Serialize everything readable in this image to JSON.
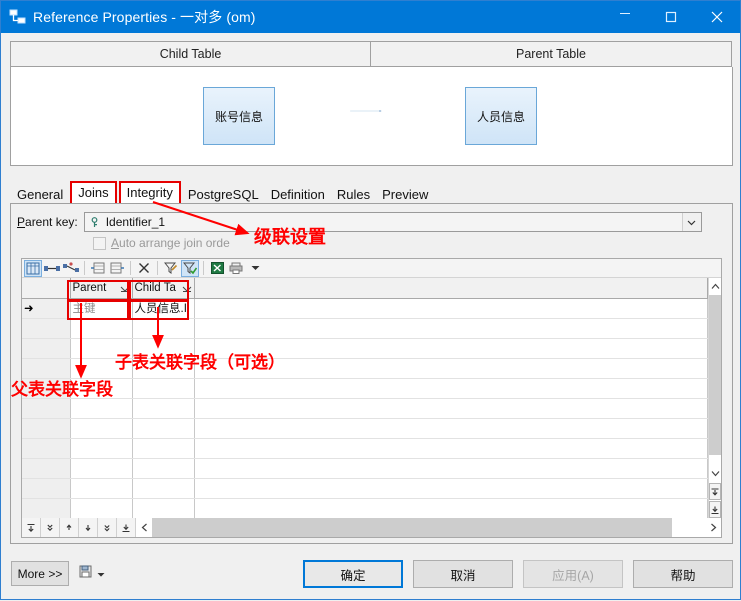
{
  "window": {
    "title": "Reference Properties - 一对多 (om)",
    "icon": "reference-icon",
    "controls": {
      "minimize": "minimize-icon",
      "maximize": "maximize-icon",
      "close": "close-icon"
    },
    "accent": "#0078d7"
  },
  "diagram": {
    "child_header": "Child Table",
    "parent_header": "Parent Table",
    "child_entity": "账号信息",
    "parent_entity": "人员信息",
    "relation": "one-to-many-arrow"
  },
  "tabs": [
    {
      "label": "General",
      "selected": false,
      "highlighted": false
    },
    {
      "label": "Joins",
      "selected": true,
      "highlighted": true
    },
    {
      "label": "Integrity",
      "selected": false,
      "highlighted": true
    },
    {
      "label": "PostgreSQL",
      "selected": false,
      "highlighted": false
    },
    {
      "label": "Definition",
      "selected": false,
      "highlighted": false
    },
    {
      "label": "Rules",
      "selected": false,
      "highlighted": false
    },
    {
      "label": "Preview",
      "selected": false,
      "highlighted": false
    }
  ],
  "joins": {
    "parent_key_label": "Parent key:",
    "parent_key_value": "Identifier_1",
    "parent_key_icon": "key-icon",
    "dropdown_icon": "chevron-down-icon",
    "auto_arrange_label": "Auto arrange join orde",
    "auto_arrange_checked": false,
    "toolbar_icons": [
      "columns-icon",
      "link-icon",
      "auto-link-icon",
      "insert-row-icon",
      "delete-row-icon",
      "remove-icon",
      "filter-icon",
      "filter-apply-icon",
      "excel-export-icon",
      "print-icon",
      "dropdown-icon"
    ],
    "grid": {
      "columns": [
        "",
        "Parent",
        "Child Ta",
        ""
      ],
      "rows": [
        {
          "marker": "➜",
          "parent": "主键",
          "child": "人员信息.I",
          "rest": ""
        },
        {
          "marker": "",
          "parent": "",
          "child": "",
          "rest": ""
        },
        {
          "marker": "",
          "parent": "",
          "child": "",
          "rest": ""
        },
        {
          "marker": "",
          "parent": "",
          "child": "",
          "rest": ""
        },
        {
          "marker": "",
          "parent": "",
          "child": "",
          "rest": ""
        },
        {
          "marker": "",
          "parent": "",
          "child": "",
          "rest": ""
        },
        {
          "marker": "",
          "parent": "",
          "child": "",
          "rest": ""
        },
        {
          "marker": "",
          "parent": "",
          "child": "",
          "rest": ""
        },
        {
          "marker": "",
          "parent": "",
          "child": "",
          "rest": ""
        },
        {
          "marker": "",
          "parent": "",
          "child": "",
          "rest": ""
        },
        {
          "marker": "",
          "parent": "",
          "child": "",
          "rest": ""
        }
      ],
      "nav_buttons": [
        "first-icon",
        "prev-page-icon",
        "prev-icon",
        "next-icon",
        "next-page-icon",
        "last-icon"
      ],
      "vscroll": {
        "up": "scroll-up-icon",
        "down": "scroll-down-icon",
        "extra_top": "top-row-icon",
        "extra_bottom": "bottom-row-icon"
      },
      "hscroll": {
        "left": "scroll-left-icon",
        "right": "scroll-right-icon"
      }
    }
  },
  "footer": {
    "more_label": "More >>",
    "tool_icon": "save-as-icon",
    "tool_dropdown": "dropdown-icon",
    "ok_label": "确定",
    "cancel_label": "取消",
    "apply_label": "应用(A)",
    "apply_disabled": true,
    "help_label": "帮助"
  },
  "annotations": {
    "color": "#ff0000",
    "cascade": "级联设置",
    "child_field": "子表关联字段（可选）",
    "parent_field": "父表关联字段"
  }
}
